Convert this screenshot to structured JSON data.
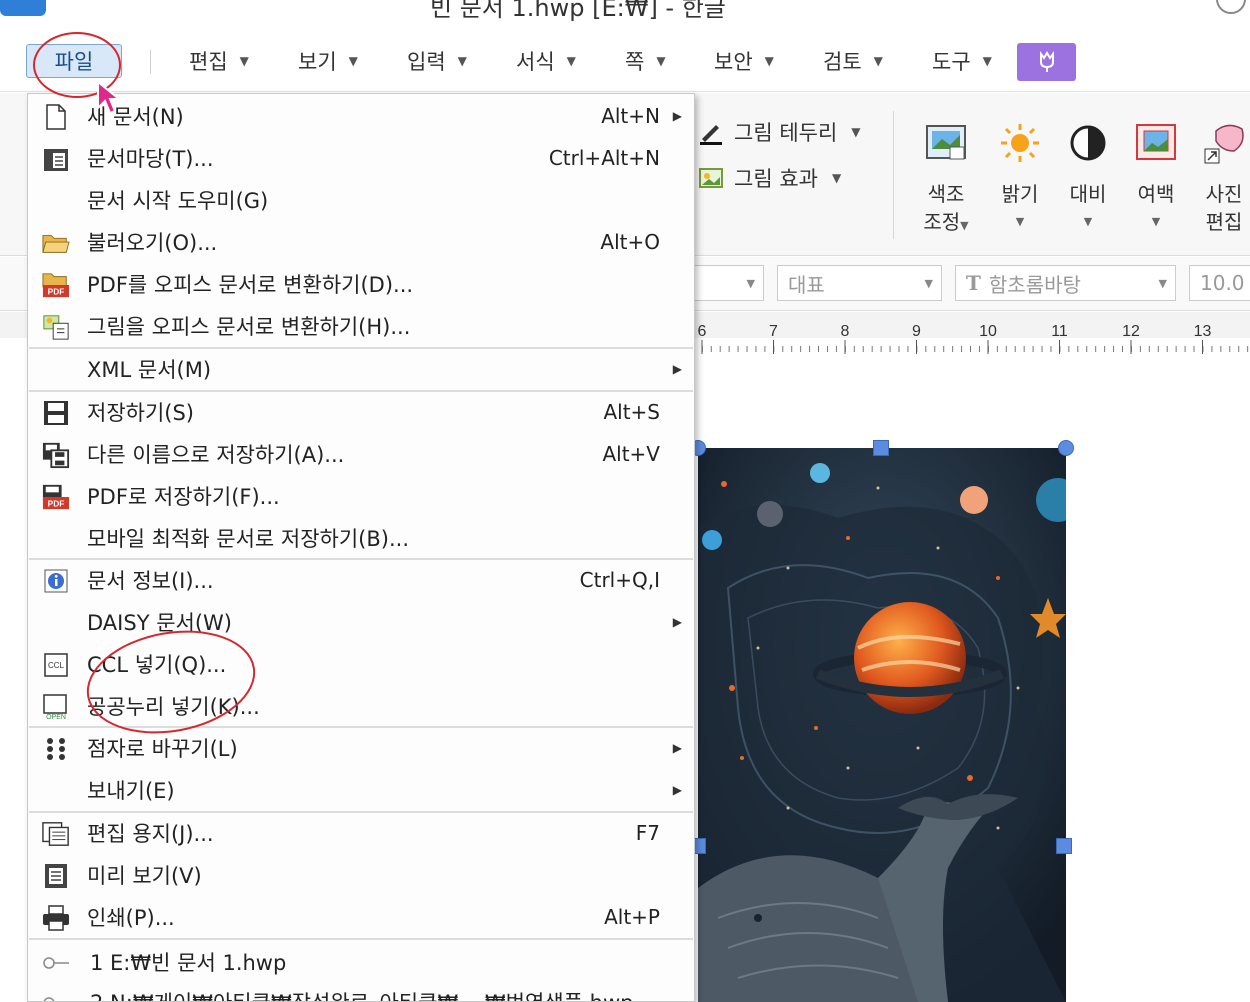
{
  "window": {
    "title": "빈 문서 1.hwp [E:₩] - 한글"
  },
  "menubar": {
    "items": [
      {
        "label": "파일"
      },
      {
        "label": "편집"
      },
      {
        "label": "보기"
      },
      {
        "label": "입력"
      },
      {
        "label": "서식"
      },
      {
        "label": "쪽"
      },
      {
        "label": "보안"
      },
      {
        "label": "검토"
      },
      {
        "label": "도구"
      }
    ]
  },
  "ribbon": {
    "picture_border": "그림 테두리",
    "picture_effect": "그림 효과",
    "color_adjust": [
      "색조",
      "조정"
    ],
    "brightness": "밝기",
    "contrast": "대비",
    "margin": "여백",
    "photo_edit": [
      "사진",
      "편집"
    ]
  },
  "formatbar": {
    "style_value": "대표",
    "font_value": "함초롬바탕",
    "font_prefix": "T",
    "size_value": "10.0"
  },
  "ruler": {
    "ticks": [
      "6",
      "7",
      "8",
      "9",
      "10",
      "11",
      "12",
      "13"
    ]
  },
  "file_menu": {
    "items": [
      {
        "label": "새 문서(N)",
        "shortcut": "Alt+N",
        "icon": "new-document-icon",
        "submenu": true
      },
      {
        "label": "문서마당(T)...",
        "shortcut": "Ctrl+Alt+N",
        "icon": "template-icon"
      },
      {
        "label": "문서 시작 도우미(G)",
        "shortcut": ""
      },
      {
        "label": "불러오기(O)...",
        "shortcut": "Alt+O",
        "icon": "open-folder-icon"
      },
      {
        "label": "PDF를 오피스 문서로 변환하기(D)...",
        "shortcut": "",
        "icon": "pdf-folder-icon"
      },
      {
        "label": "그림을 오피스 문서로 변환하기(H)...",
        "shortcut": "",
        "icon": "image-convert-icon"
      },
      {
        "label": "XML 문서(M)",
        "shortcut": "",
        "submenu": true
      },
      {
        "label": "저장하기(S)",
        "shortcut": "Alt+S",
        "icon": "save-icon"
      },
      {
        "label": "다른 이름으로 저장하기(A)...",
        "shortcut": "Alt+V",
        "icon": "save-as-icon"
      },
      {
        "label": "PDF로 저장하기(F)...",
        "shortcut": "",
        "icon": "save-pdf-icon"
      },
      {
        "label": "모바일 최적화 문서로 저장하기(B)...",
        "shortcut": ""
      },
      {
        "label": "문서 정보(I)...",
        "shortcut": "Ctrl+Q,I",
        "icon": "info-icon"
      },
      {
        "label": "DAISY 문서(W)",
        "shortcut": "",
        "submenu": true
      },
      {
        "label": "CCL 넣기(Q)...",
        "shortcut": "",
        "icon": "ccl-icon"
      },
      {
        "label": "공공누리 넣기(K)...",
        "shortcut": "",
        "icon": "open-license-icon"
      },
      {
        "label": "점자로 바꾸기(L)",
        "shortcut": "",
        "icon": "braille-icon",
        "submenu": true
      },
      {
        "label": "보내기(E)",
        "shortcut": "",
        "submenu": true
      },
      {
        "label": "편집 용지(J)...",
        "shortcut": "F7",
        "icon": "page-setup-icon"
      },
      {
        "label": "미리 보기(V)",
        "shortcut": "",
        "icon": "preview-icon"
      },
      {
        "label": "인쇄(P)...",
        "shortcut": "Alt+P",
        "icon": "print-icon"
      }
    ],
    "recent": [
      {
        "label": "1 E:₩빈 문서 1.hwp"
      },
      {
        "label": "2 N:₩게이₩아티클₩작성완료_아티클₩... ₩번역샘플.hwp"
      }
    ]
  },
  "colors": {
    "accent": "#2f7fd8",
    "highlight_ring": "#d8262e",
    "plugin": "#9b72e0"
  }
}
